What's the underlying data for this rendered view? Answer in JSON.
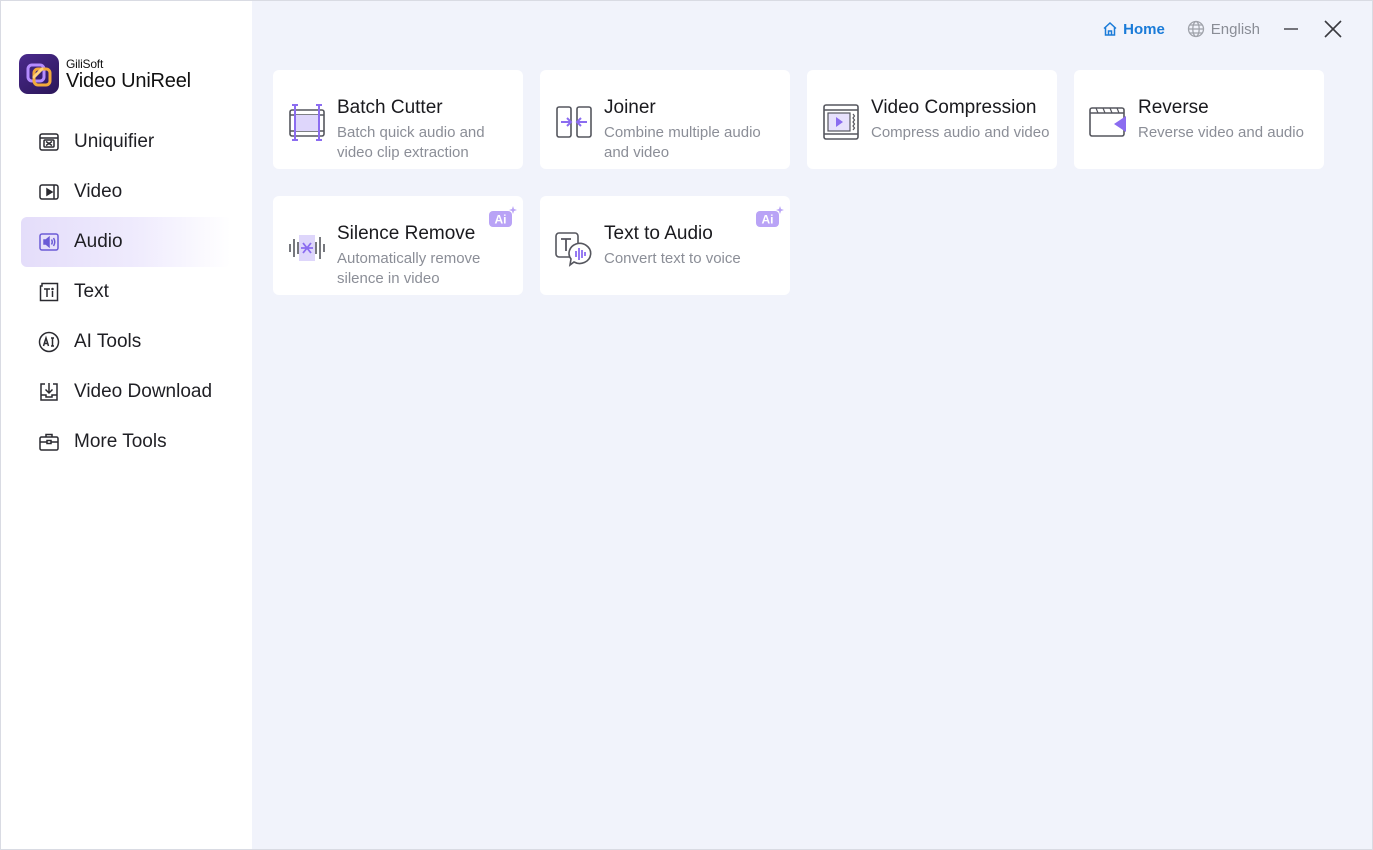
{
  "brand": {
    "company": "GiliSoft",
    "product": "Video UniReel"
  },
  "topbar": {
    "home_label": "Home",
    "language_label": "English"
  },
  "colors": {
    "accent_purple": "#8b6cf0",
    "home_blue": "#1a7bd8",
    "active_nav_bg": "#e4ddfa"
  },
  "sidebar": {
    "items": [
      {
        "label": "Uniquifier",
        "icon": "uniquifier-icon",
        "active": false
      },
      {
        "label": "Video",
        "icon": "video-icon",
        "active": false
      },
      {
        "label": "Audio",
        "icon": "audio-icon",
        "active": true
      },
      {
        "label": "Text",
        "icon": "text-icon",
        "active": false
      },
      {
        "label": "AI Tools",
        "icon": "ai-tools-icon",
        "active": false
      },
      {
        "label": "Video Download",
        "icon": "download-icon",
        "active": false
      },
      {
        "label": "More Tools",
        "icon": "toolbox-icon",
        "active": false
      }
    ]
  },
  "tools": [
    {
      "title": "Batch Cutter",
      "desc": "Batch quick audio and video clip extraction",
      "icon": "batch-cutter-icon",
      "ai": false
    },
    {
      "title": "Joiner",
      "desc": "Combine multiple audio and video",
      "icon": "joiner-icon",
      "ai": false
    },
    {
      "title": "Video Compression",
      "desc": "Compress audio and video",
      "icon": "compression-icon",
      "ai": false
    },
    {
      "title": "Reverse",
      "desc": "Reverse video and audio",
      "icon": "reverse-icon",
      "ai": false
    },
    {
      "title": "Silence Remove",
      "desc": "Automatically remove silence in video",
      "icon": "silence-remove-icon",
      "ai": true,
      "badge": "Ai"
    },
    {
      "title": "Text to Audio",
      "desc": "Convert text to voice",
      "icon": "text-to-audio-icon",
      "ai": true,
      "badge": "Ai"
    }
  ]
}
